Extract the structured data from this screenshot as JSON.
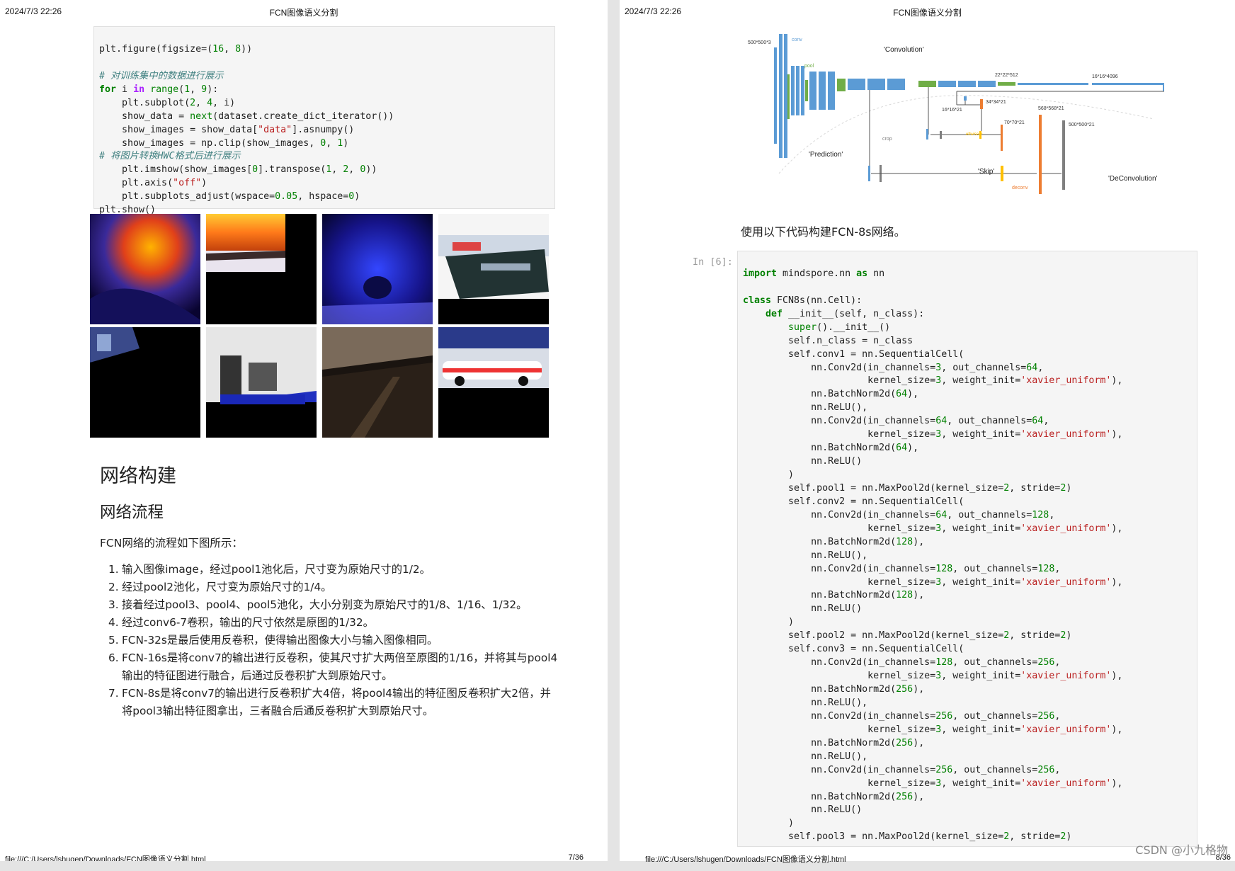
{
  "left_page": {
    "header_date": "2024/7/3 22:26",
    "header_title": "FCN图像语义分割",
    "footer_path": "file:///C:/Users/lshugen/Downloads/FCN图像语义分割.html",
    "page_number": "7/36",
    "heading_main": "网络构建",
    "heading_sub": "网络流程",
    "intro": "FCN网络的流程如下图所示：",
    "steps": [
      {
        "n": "1.",
        "text": "输入图像image，经过pool1池化后，尺寸变为原始尺寸的1/2。"
      },
      {
        "n": "2.",
        "text": "经过pool2池化，尺寸变为原始尺寸的1/4。"
      },
      {
        "n": "3.",
        "text": "接着经过pool3、pool4、pool5池化，大小分别变为原始尺寸的1/8、1/16、1/32。"
      },
      {
        "n": "4.",
        "text": "经过conv6-7卷积，输出的尺寸依然是原图的1/32。"
      },
      {
        "n": "5.",
        "text": "FCN-32s是最后使用反卷积，使得输出图像大小与输入图像相同。"
      },
      {
        "n": "6.",
        "text": "FCN-16s是将conv7的输出进行反卷积，使其尺寸扩大两倍至原图的1/16，并将其与pool4输出的特征图进行融合，后通过反卷积扩大到原始尺寸。"
      },
      {
        "n": "7.",
        "text": "FCN-8s是将conv7的输出进行反卷积扩大4倍，将pool4输出的特征图反卷积扩大2倍，并将pool3输出特征图拿出，三者融合后通反卷积扩大到原始尺寸。"
      }
    ]
  },
  "right_page": {
    "header_date": "2024/7/3 22:26",
    "header_title": "FCN图像语义分割",
    "footer_path": "file:///C:/Users/lshugen/Downloads/FCN图像语义分割.html",
    "page_number": "8/36",
    "caption": "使用以下代码构建FCN-8s网络。",
    "cell_prompt": "In [6]:",
    "diagram": {
      "convolution": "'Convolution'",
      "prediction": "'Prediction'",
      "skip": "'Skip'",
      "deconvolution": "'DeConvolution'",
      "conv": "conv",
      "pool": "pool",
      "crop": "crop",
      "eltwise": "eltwise +",
      "deconv": "deconv",
      "in_size": "500*500*3",
      "s22": "22*22*512",
      "s16big": "16*16*4096",
      "s34": "34*34*21",
      "s16": "16*16*21",
      "s70": "70*70*21",
      "s568": "568*568*21",
      "out_size": "500*500*21"
    }
  },
  "colors": {
    "keyword": "#008000",
    "string": "#ba2121",
    "comment": "#408080",
    "operator_word": "#aa22ff",
    "conv_blue": "#5b9bd5",
    "pool_green": "#70ad47",
    "deconv_orange": "#ed7d31",
    "eltwise_yellow": "#ffc000",
    "out_gray": "#7f7f7f"
  },
  "watermark": "CSDN @小九格物"
}
